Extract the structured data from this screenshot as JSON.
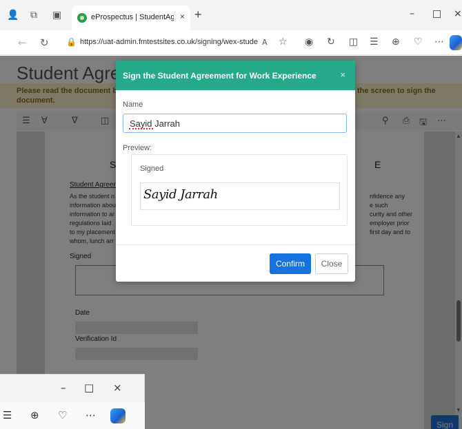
{
  "browser": {
    "tab_title": "eProspectus | StudentAgreement",
    "tab_close": "×",
    "new_tab": "+",
    "url": "https://uat-admin.fmtestsites.co.uk/signing/wex-student...",
    "controls": {
      "minimize": "–",
      "maximize": "□",
      "close": "×"
    }
  },
  "page": {
    "title": "Student Agree",
    "warning_line1": "Please read the document be",
    "warning_line1_right": "the screen to sign the",
    "warning_line2": "document.",
    "doc": {
      "heading_left": "S",
      "heading_right": "E",
      "subheading": "Student Agreem",
      "text_lines": [
        "As the student n",
        "information abou",
        "information to ar",
        "regulations laid",
        "to my placement",
        "whom, lunch arr"
      ],
      "text_right": [
        "nfidence any",
        "e such",
        "curity and other",
        "employer prior",
        "first day and to"
      ],
      "signed_label": "Signed",
      "date_label": "Date",
      "verification_label": "Verification Id"
    },
    "sign_button": "Sign"
  },
  "modal": {
    "title": "Sign the Student Agreement for Work Experience",
    "close": "×",
    "name_label": "Name",
    "name_value": "Sayid Jarrah",
    "preview_label": "Preview:",
    "signed_label": "Signed",
    "signature_text": "Sayid Jarrah",
    "confirm_label": "Confirm",
    "close_label": "Close"
  },
  "colors": {
    "modal_header": "#26a88a",
    "primary": "#1672e0",
    "warning_bg": "#fdf2cf"
  }
}
